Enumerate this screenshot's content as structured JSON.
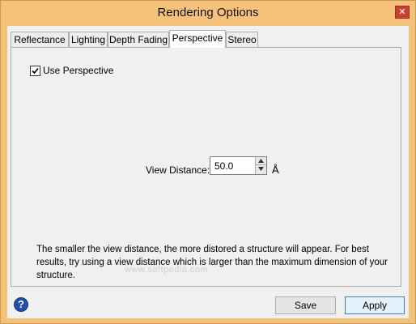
{
  "window": {
    "title": "Rendering Options",
    "close_glyph": "✕"
  },
  "tabs": [
    {
      "label": "Reflectance",
      "active": false
    },
    {
      "label": "Lighting",
      "active": false
    },
    {
      "label": "Depth Fading",
      "active": false
    },
    {
      "label": "Perspective",
      "active": true
    },
    {
      "label": "Stereo",
      "active": false
    }
  ],
  "perspective": {
    "use_perspective_label": "Use Perspective",
    "use_perspective_checked": true,
    "view_distance_label": "View Distance:",
    "view_distance_value": "50.0",
    "view_distance_unit": "Å",
    "help_text": "The smaller the view distance, the more distored a structure will appear. For best results, try using a view distance which is larger than the maximum dimension of your structure.",
    "watermark": "www.softpedia.com"
  },
  "footer": {
    "help_glyph": "?",
    "save_label": "Save",
    "apply_label": "Apply"
  },
  "colors": {
    "title_bar": "#f4c27b",
    "close_button": "#c9412f",
    "help_icon": "#1f4fa7",
    "default_button_border": "#3c7fb1"
  }
}
